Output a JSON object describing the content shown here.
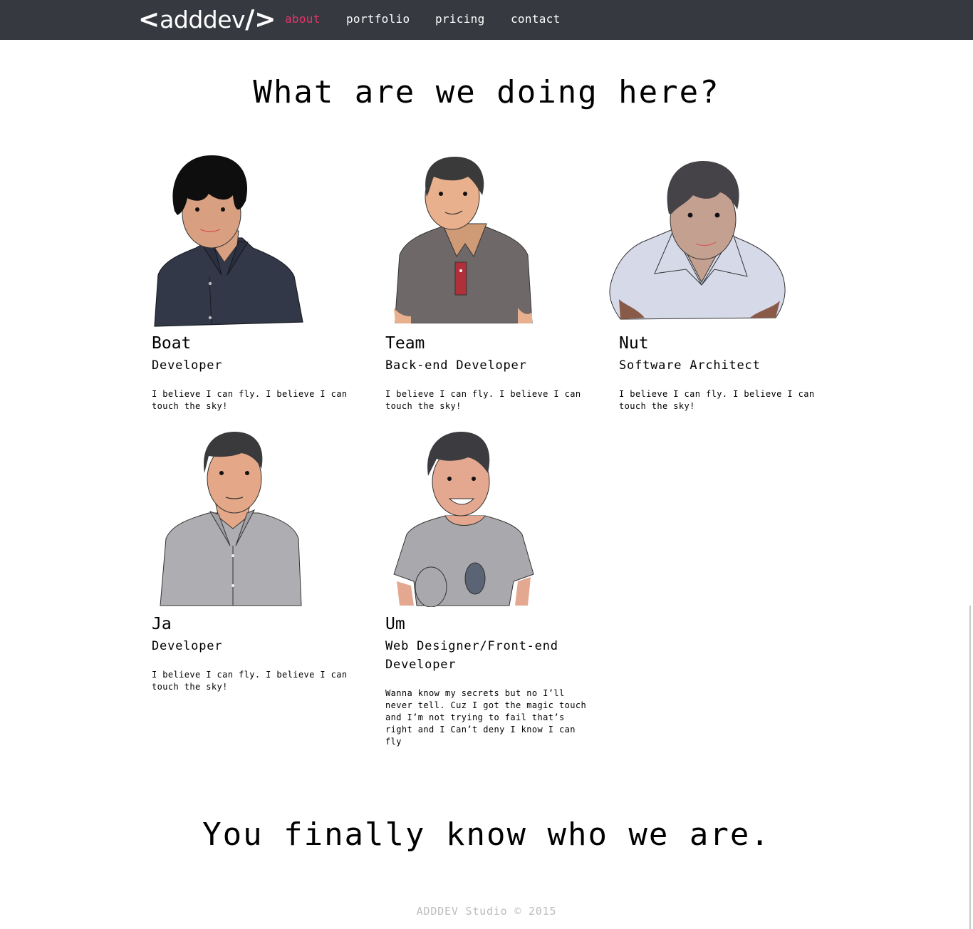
{
  "nav": {
    "logo_text": "adddev",
    "links": [
      {
        "label": "about",
        "active": true
      },
      {
        "label": "portfolio",
        "active": false
      },
      {
        "label": "pricing",
        "active": false
      },
      {
        "label": "contact",
        "active": false
      }
    ]
  },
  "heading": "What are we doing here?",
  "members": [
    {
      "name": "Boat",
      "role": "Developer",
      "bio": "I believe I can fly. I believe I can touch the sky!"
    },
    {
      "name": "Team",
      "role": "Back-end Developer",
      "bio": "I believe I can fly. I believe I can touch the sky!"
    },
    {
      "name": "Nut",
      "role": "Software Architect",
      "bio": "I believe I can fly. I believe I can touch the sky!"
    },
    {
      "name": "Ja",
      "role": "Developer",
      "bio": "I believe I can fly. I believe I can touch the sky!"
    },
    {
      "name": "Um",
      "role": "Web Designer/Front-end Developer",
      "bio": "Wanna know my secrets but no I’ll never tell. Cuz I got the magic touch and I’m not trying to fail that’s right and I Can’t deny I know I can fly"
    }
  ],
  "closing": "You finally know who we are.",
  "footer": "ADDDEV Studio © 2015",
  "colors": {
    "navbar_bg": "#363940",
    "nav_active": "#e8336a",
    "footer_text": "#bcbcbc"
  }
}
